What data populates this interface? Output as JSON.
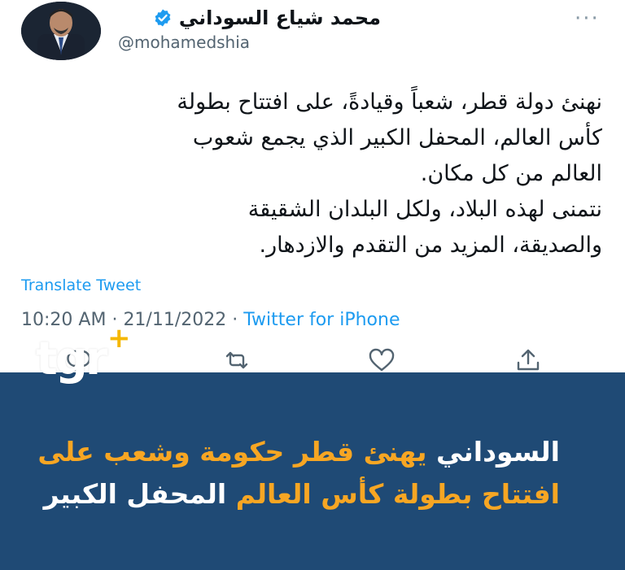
{
  "colors": {
    "banner_bg": "#1f4a75",
    "accent_orange": "#f7a623",
    "twitter_blue": "#1d9bf0",
    "logo_plus": "#f5b700"
  },
  "tweet": {
    "display_name": "محمد شياع السوداني",
    "handle": "@mohamedshia",
    "verified_icon": "verified-badge-icon",
    "more_icon": "more-dots-icon",
    "more_text": "···",
    "body_lines": [
      "نهنئ دولة قطر، شعباً وقيادةً، على افتتاح بطولة",
      "كأس العالم، المحفل الكبير الذي يجمع شعوب",
      "العالم من كل مكان.",
      "نتمنى لهذه البلاد، ولكل البلدان الشقيقة",
      "والصديقة، المزيد من التقدم والازدهار."
    ],
    "translate_label": "Translate Tweet",
    "time": "10:20 AM",
    "date": "21/11/2022",
    "separator": "·",
    "source": "Twitter for iPhone",
    "actions": [
      "reply-icon",
      "retweet-icon",
      "like-icon",
      "share-icon"
    ]
  },
  "watermark": {
    "logo_text": "tgr",
    "logo_plus": "+"
  },
  "banner": {
    "headline_part1": "السوداني",
    "headline_part2": "يهنئ قطر حكومة وشعب على",
    "headline_part3": "افتتاح بطولة كأس العالم",
    "headline_part4": "المحفل الكبير"
  }
}
